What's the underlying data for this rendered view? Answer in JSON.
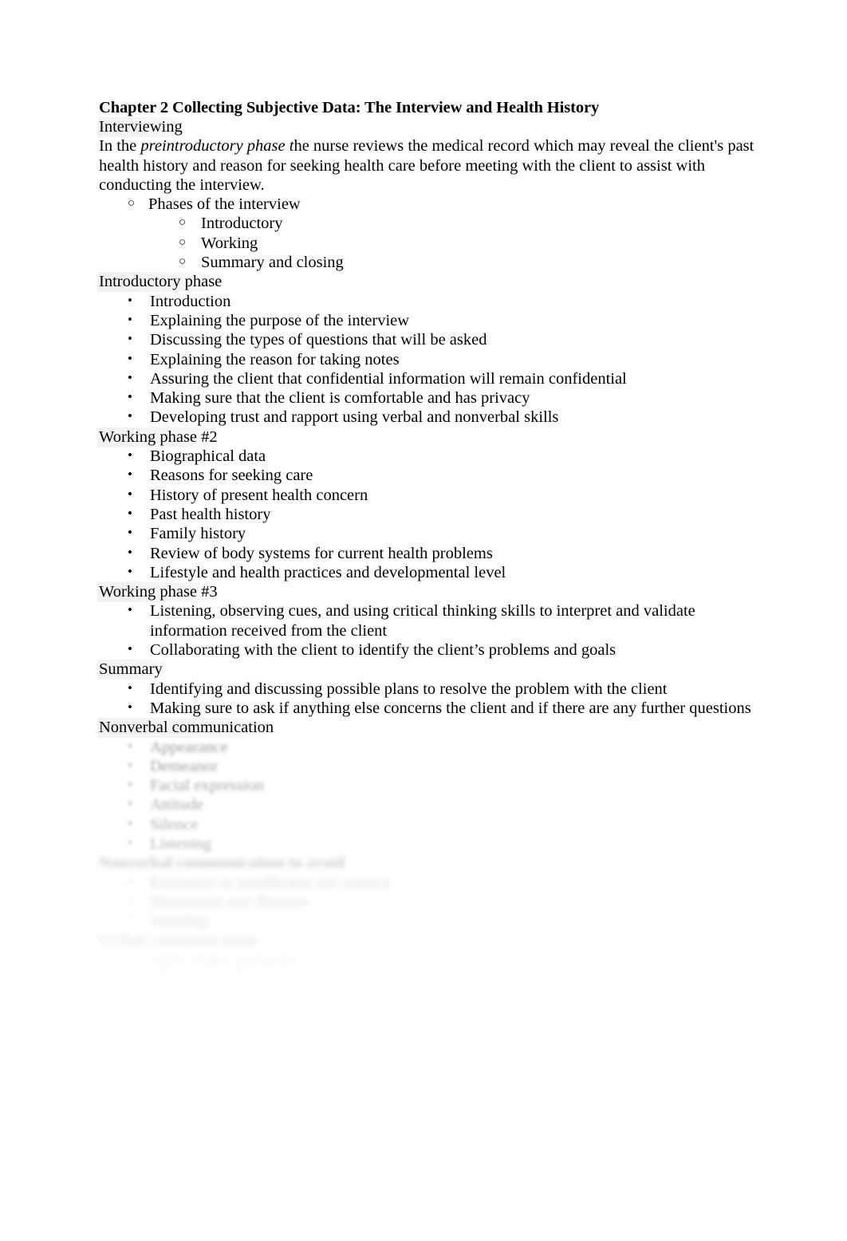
{
  "document": {
    "title": "Chapter 2 Collecting Subjective Data: The Interview and Health History",
    "bullet_glyphs": {
      "disc": "•",
      "circle": "○"
    }
  },
  "sections": {
    "interviewing": {
      "heading": "Interviewing",
      "paragraph_lead": "In the ",
      "paragraph_italic": "preintroductory phase t",
      "paragraph_rest": "he nurse reviews the medical record which may reveal the client's past health history and reason for seeking health care before meeting with the client to assist with conducting the interview.",
      "phases_item": "Phases of the interview",
      "phases_subitems": [
        "Introductory",
        "Working",
        "Summary and closing"
      ]
    },
    "introductory_phase": {
      "heading": "Introductory phase",
      "items": [
        "Introduction",
        "Explaining the purpose of the interview",
        "Discussing the types of questions that will be asked",
        "Explaining the reason for taking notes",
        "Assuring the client that confidential information will remain confidential",
        "Making sure that the client is comfortable and has privacy",
        "Developing trust and rapport using verbal and nonverbal skills"
      ]
    },
    "working_phase_2": {
      "heading": "Working phase #2",
      "items": [
        "Biographical data",
        "Reasons for seeking care",
        "History of present health concern",
        "Past health history",
        "Family history",
        "Review of body systems for current health problems",
        "Lifestyle and health practices and developmental level"
      ]
    },
    "working_phase_3": {
      "heading": "Working phase #3",
      "items": [
        "Listening, observing cues, and using critical thinking skills to interpret and validate information received from the client",
        "Collaborating with the client to identify the client’s problems and goals"
      ]
    },
    "summary": {
      "heading": "Summary",
      "items": [
        "Identifying and discussing possible plans to resolve the problem with the client",
        "Making sure to ask if anything else concerns the client and if there are any further questions"
      ]
    },
    "nonverbal_communication": {
      "heading": "Nonverbal communication",
      "items_obscured": [
        "Appearance",
        "Demeanor",
        "Facial expression",
        "Attitude",
        "Silence",
        "Listening"
      ]
    },
    "obscured_section_b": {
      "heading": "Nonverbal communication to avoid",
      "items_obscured": [
        "Excessive or insufficient eye contact",
        "Distraction and distance",
        "Standing"
      ]
    },
    "obscured_section_c": {
      "heading": "Verbal communication",
      "items_obscured": [
        "Open-ended questions"
      ]
    }
  }
}
